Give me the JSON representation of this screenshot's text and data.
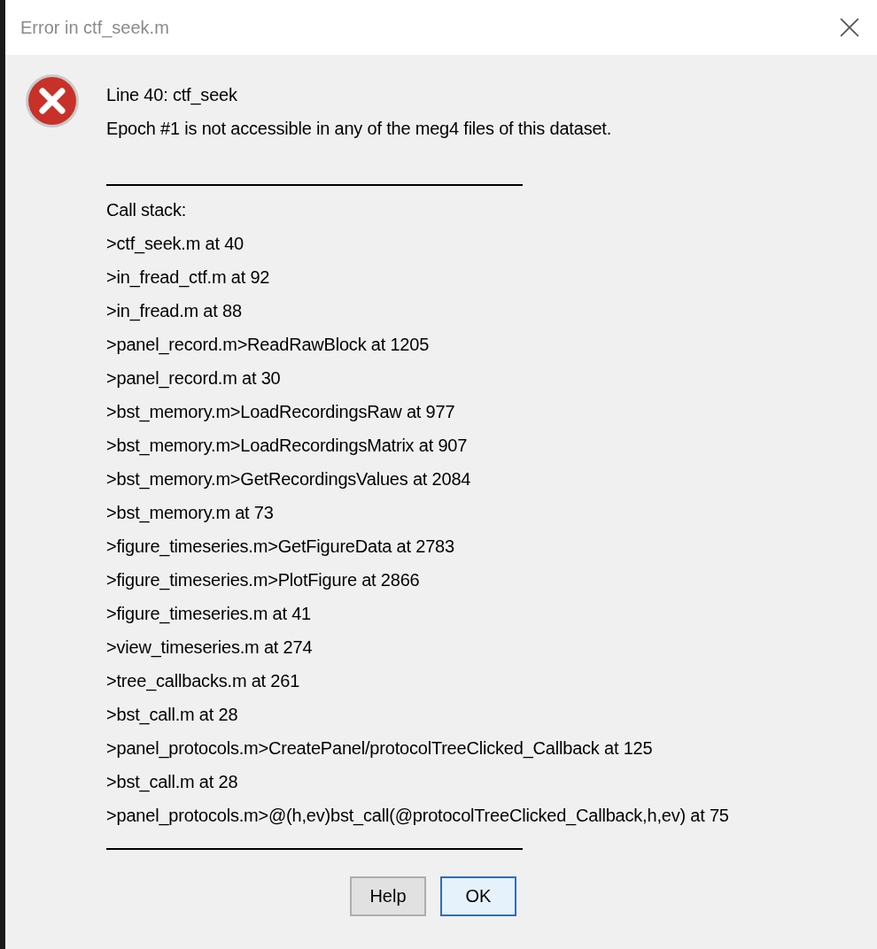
{
  "window": {
    "title": "Error in ctf_seek.m"
  },
  "message": [
    "Line 40:  ctf_seek",
    "Epoch #1 is not accessible in any of the meg4 files of this dataset."
  ],
  "call_stack_label": "Call stack:",
  "call_stack": [
    ">ctf_seek.m at 40",
    ">in_fread_ctf.m at 92",
    ">in_fread.m at 88",
    ">panel_record.m>ReadRawBlock at 1205",
    ">panel_record.m at 30",
    ">bst_memory.m>LoadRecordingsRaw at 977",
    ">bst_memory.m>LoadRecordingsMatrix at 907",
    ">bst_memory.m>GetRecordingsValues at 2084",
    ">bst_memory.m at 73",
    ">figure_timeseries.m>GetFigureData at 2783",
    ">figure_timeseries.m>PlotFigure at 2866",
    ">figure_timeseries.m at 41",
    ">view_timeseries.m at 274",
    ">tree_callbacks.m at 261",
    ">bst_call.m at 28",
    ">panel_protocols.m>CreatePanel/protocolTreeClicked_Callback at 125",
    ">bst_call.m at 28",
    ">panel_protocols.m>@(h,ev)bst_call(@protocolTreeClicked_Callback,h,ev) at 75"
  ],
  "buttons": [
    {
      "label": "Help",
      "default": false
    },
    {
      "label": "OK",
      "default": true
    }
  ]
}
